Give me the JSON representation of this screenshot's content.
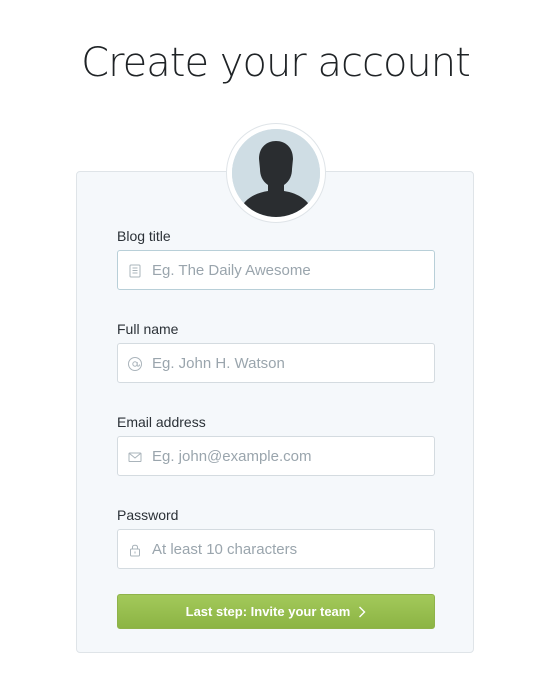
{
  "page": {
    "title": "Create your account"
  },
  "avatar": {
    "icon": "user-silhouette-icon"
  },
  "form": {
    "blog_title": {
      "label": "Blog title",
      "placeholder": "Eg. The Daily Awesome",
      "value": "",
      "icon": "document-icon"
    },
    "full_name": {
      "label": "Full name",
      "placeholder": "Eg. John H. Watson",
      "value": "",
      "icon": "at-sign-icon"
    },
    "email": {
      "label": "Email address",
      "placeholder": "Eg. john@example.com",
      "value": "",
      "icon": "envelope-icon"
    },
    "password": {
      "label": "Password",
      "placeholder": "At least 10 characters",
      "value": "",
      "icon": "lock-icon"
    },
    "submit": {
      "label": "Last step: Invite your team",
      "icon": "chevron-right-icon"
    }
  },
  "colors": {
    "accent_green": "#9cc152",
    "card_background": "#f5f8fb",
    "avatar_background": "#cfdde4"
  }
}
